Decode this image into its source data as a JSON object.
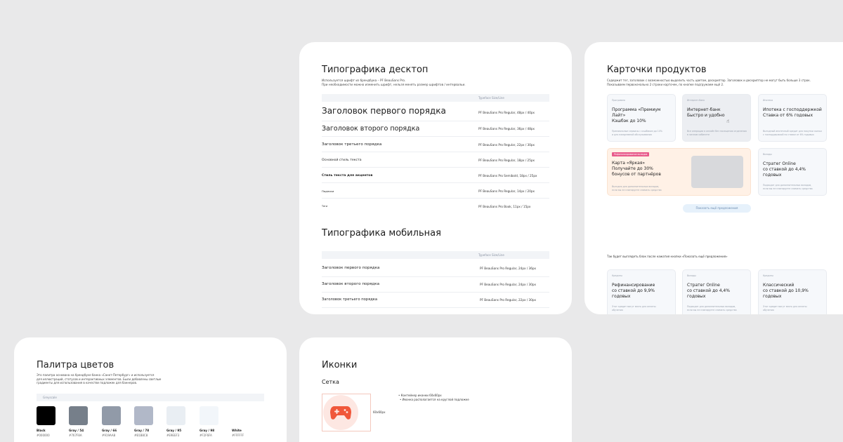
{
  "typography_desktop": {
    "title": "Типографика десктоп",
    "desc_line1": "Используется шрифт из брендбука – PF BeauSans Pro.",
    "desc_line2": "При необходимости можно изменить шрифт, нельзя менять размер шрифтов / интервальи.",
    "header_col": "Typeface Size/Line",
    "rows": [
      {
        "name": "Заголовок первого порядка",
        "spec": "PF BeauSans Pro Regular, 48px / 40px"
      },
      {
        "name": "Заголовок второго порядка",
        "spec": "PF BeauSans Pro Regular, 36px / 48px"
      },
      {
        "name": "Заголовок третьего порядка",
        "spec": "PF BeauSans Pro Regular, 22px / 30px"
      },
      {
        "name": "Основной стиль текста",
        "spec": "PF BeauSans Pro Regular, 18px / 25px"
      },
      {
        "name": "Стиль текста для акцентов",
        "spec": "PF BeauSans Pro Semibold, 18px / 25px"
      },
      {
        "name": "Подписи",
        "spec": "PF BeauSans Pro Regular, 14px / 20px"
      },
      {
        "name": "Теги",
        "spec": "PF BeauSans Pro Book, 11px / 15px"
      }
    ]
  },
  "typography_mobile": {
    "title": "Типографика мобильная",
    "header_col": "Typeface Size/Line",
    "rows": [
      {
        "name": "Заголовок первого порядка",
        "spec": "PF BeauSans Pro Regular, 24px / 36px"
      },
      {
        "name": "Заголовок второго порядка",
        "spec": "PF BeauSans Pro Regular, 24px / 30px"
      },
      {
        "name": "Заголовок третьего порядка",
        "spec": "PF BeauSans Pro Regular, 22px / 30px"
      }
    ]
  },
  "products": {
    "title": "Карточки продуктов",
    "desc_line1": "Содержит тег, заголовок с возможностью выделить часть цветом, дескриптор. Заголовок и дескриптор не могут быть больше 3 строк.",
    "desc_line2": "Показываем первоначально 2 строки карточек, по кнопке подгружаем ещё 2.",
    "cards": [
      {
        "tag": "Программа",
        "title_l1": "Программа «Премиум Лайт»",
        "title_l2": "Кэшбэк до 10%",
        "desc_l1": "Премиальные сервисы с кэшбэком до 10%",
        "desc_l2": "и для ежедневной обслуживания"
      },
      {
        "tag": "Интернет-банк",
        "title_l1": "Интернет-банк",
        "title_l2": "Быстро и удобно",
        "desc_l1": "Все операции в онлайн без посещения отделения",
        "desc_l2": "в личном кабинете"
      },
      {
        "tag": "Ипотека",
        "title_l1": "Ипотека с господдержкой",
        "title_l2": "Ставка от 6% годовых",
        "desc_l1": "Выгодный ипотечный кредит для покупки жилья",
        "desc_l2": "с господдержкой по ставке от 6% годовых"
      },
      {
        "tag": "Рефинансирование вкладов",
        "title_l1": "Карта «Яркая»",
        "title_l2": "Получайте до 30%",
        "title_l3": "бонусов от партнёров",
        "desc_l1": "Выгодно для дополнительных вкладов,",
        "desc_l2": "если вы не планируете снимать средства"
      },
      {
        "tag": "Вклады",
        "title_l1": "Стратег Online",
        "title_l2": "со ставкой до 4,4%",
        "title_l3": "годовых",
        "desc_l1": "Подходит для дополнительных вкладов,",
        "desc_l2": "если вы не планируете снимать средства"
      }
    ],
    "more_button": "Показать ещё предложения",
    "after_text": "Так будет выглядеть блок после нажатия кнопки «Показать ещё предложения»",
    "more_cards": [
      {
        "tag": "Кредиты",
        "title_l1": "Рефинансирование",
        "title_l2": "со ставкой до 9,9%",
        "title_l3": "годовых",
        "desc_l1": "Этот кредит могут взять для оплаты",
        "desc_l2": "обучения"
      },
      {
        "tag": "Вклады",
        "title_l1": "Стратег Online",
        "title_l2": "со ставкой до 4,4%",
        "title_l3": "годовых",
        "desc_l1": "Подходит для дополнительных вкладов,",
        "desc_l2": "если вы не планируете снимать средства"
      },
      {
        "tag": "Кредиты",
        "title_l1": "Классический",
        "title_l2": "со ставкой до 10,9%",
        "title_l3": "годовых",
        "desc_l1": "Этот кредит могут взять для оплаты",
        "desc_l2": "обучения"
      }
    ]
  },
  "palette": {
    "title": "Палитра цветов",
    "desc_line1": "Это палитра основана на брендбуке банка «Санкт-Петербург» и используется",
    "desc_line2": "для иллюстраций, статусов и интерактивных элементов. Были добавлены светлые",
    "desc_line3": "градиенты для использования в качестве подложек для баннеров.",
    "group_label": "Greyscale",
    "swatches": [
      {
        "name": "Black",
        "hex": "#000000",
        "color": "#000000"
      },
      {
        "name": "Gray / 54",
        "hex": "#767F8A",
        "color": "#767F8A"
      },
      {
        "name": "Gray / 66",
        "hex": "#919AA8",
        "color": "#919AA8"
      },
      {
        "name": "Gray / 78",
        "hex": "#B1B8C8",
        "color": "#B1B8C8"
      },
      {
        "name": "Gray / 95",
        "hex": "#E9EEF3",
        "color": "#E9EEF3"
      },
      {
        "name": "Gray / 98",
        "hex": "#F2F6FA",
        "color": "#F2F6FA"
      },
      {
        "name": "White",
        "hex": "#FFFFFF",
        "color": "#FFFFFF"
      }
    ]
  },
  "icons": {
    "title": "Иконки",
    "subtitle": "Сетка",
    "size_label": "60x60px",
    "note_line1": "• Контейнер иконки 60х60px",
    "note_line2": "• Иконка располагается на круглой подложке",
    "icon_name": "gamepad-icon",
    "accent": "#f0573a",
    "bg": "#fde7e2"
  },
  "colors": {
    "bg": "#e9e9ea",
    "card_bg": "#ffffff",
    "button_bg": "#e6f1fb",
    "tag_pink": "#e85a8a",
    "promo_bg": "#fff1e6"
  }
}
